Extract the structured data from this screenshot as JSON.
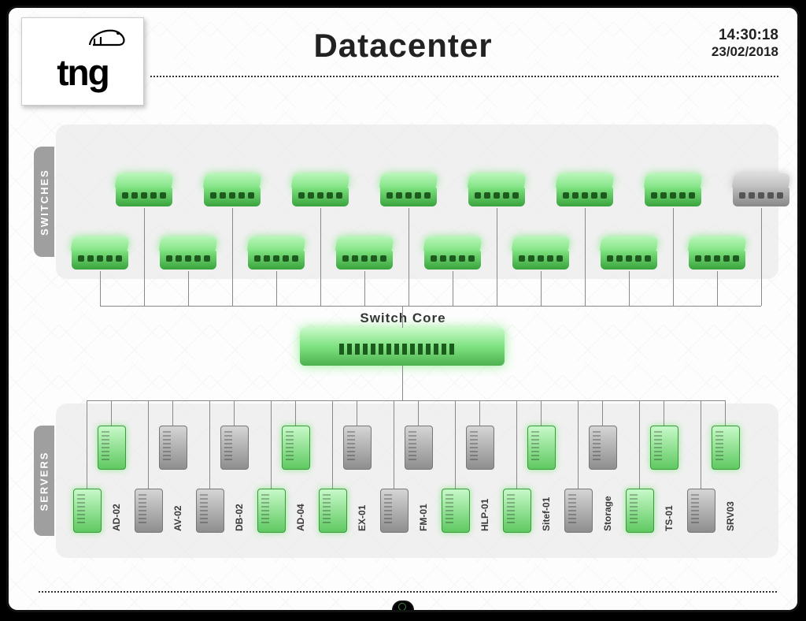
{
  "brand": "tng",
  "page_title": "Datacenter",
  "clock": {
    "time": "14:30:18",
    "date": "23/02/2018"
  },
  "panels": {
    "switches_label": "SWITCHES",
    "servers_label": "SERVERS"
  },
  "core_label": "Switch   Core",
  "switches_top_row": [
    {
      "status": "green"
    },
    {
      "status": "green"
    },
    {
      "status": "green"
    },
    {
      "status": "green"
    },
    {
      "status": "green"
    },
    {
      "status": "green"
    },
    {
      "status": "green"
    },
    {
      "status": "gray"
    }
  ],
  "switches_bottom_row": [
    {
      "status": "green"
    },
    {
      "status": "green"
    },
    {
      "status": "green"
    },
    {
      "status": "green"
    },
    {
      "status": "green"
    },
    {
      "status": "green"
    },
    {
      "status": "green"
    },
    {
      "status": "green"
    }
  ],
  "servers_top_row": [
    {
      "status": "green"
    },
    {
      "status": "gray"
    },
    {
      "status": "gray"
    },
    {
      "status": "green"
    },
    {
      "status": "gray"
    },
    {
      "status": "gray"
    },
    {
      "status": "gray"
    },
    {
      "status": "green"
    },
    {
      "status": "gray"
    },
    {
      "status": "green"
    },
    {
      "status": "green"
    }
  ],
  "servers_bottom_row": [
    {
      "label": "AD-02",
      "status": "green"
    },
    {
      "label": "AV-02",
      "status": "gray"
    },
    {
      "label": "DB-02",
      "status": "gray"
    },
    {
      "label": "AD-04",
      "status": "green"
    },
    {
      "label": "EX-01",
      "status": "green"
    },
    {
      "label": "FM-01",
      "status": "gray"
    },
    {
      "label": "HLP-01",
      "status": "green"
    },
    {
      "label": "Sitef-01",
      "status": "green"
    },
    {
      "label": "Storage",
      "status": "gray"
    },
    {
      "label": "TS-01",
      "status": "green"
    },
    {
      "label": "SRV03",
      "status": "gray"
    }
  ]
}
